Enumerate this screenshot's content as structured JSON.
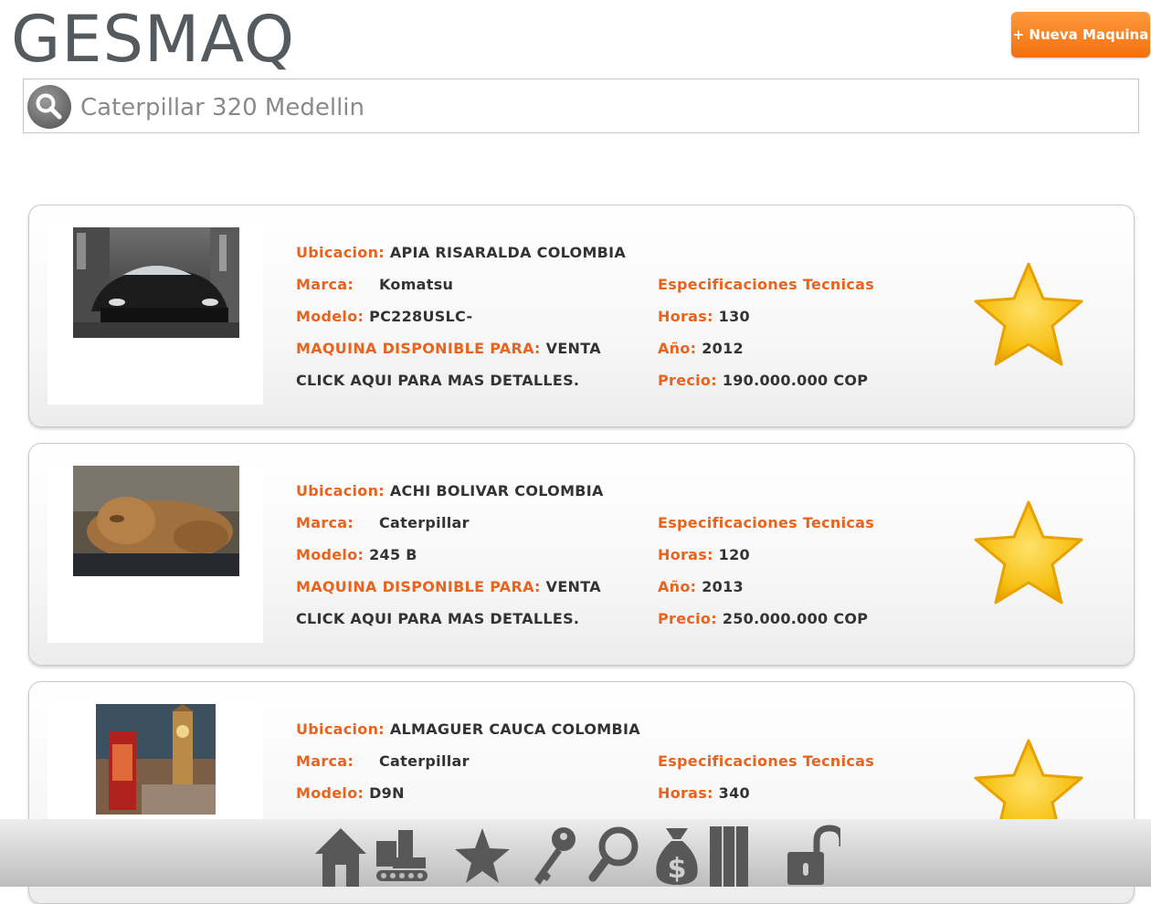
{
  "app": {
    "title": "GESMAQ",
    "new_button": "+ Nueva Maquina"
  },
  "search": {
    "value": "",
    "placeholder": "Caterpillar 320 Medellin"
  },
  "labels": {
    "ubicacion": "Ubicacion:",
    "marca": "Marca:",
    "modelo": "Modelo:",
    "disponible": "MAQUINA DISPONIBLE PARA:",
    "especificaciones": "Especificaciones Tecnicas",
    "horas": "Horas:",
    "anio": "Año:",
    "precio": "Precio:",
    "detalles": "CLICK AQUI PARA MAS DETALLES."
  },
  "listings": [
    {
      "ubicacion": "APIA RISARALDA COLOMBIA",
      "marca": "Komatsu",
      "modelo": "PC228USLC-",
      "disponible": "VENTA",
      "horas": "130",
      "anio": "2012",
      "precio": "190.000.000 COP",
      "image": "sports-car-photo"
    },
    {
      "ubicacion": "ACHI BOLIVAR COLOMBIA",
      "marca": "Caterpillar",
      "modelo": "245 B",
      "disponible": "VENTA",
      "horas": "120",
      "anio": "2013",
      "precio": "250.000.000 COP",
      "image": "lion-cub-photo"
    },
    {
      "ubicacion": "ALMAGUER CAUCA COLOMBIA",
      "marca": "Caterpillar",
      "modelo": "D9N",
      "disponible": "",
      "horas": "340",
      "anio": "",
      "precio": "",
      "image": "london-big-ben-photo"
    }
  ],
  "nav": [
    "home-icon",
    "machinery-icon",
    "star-icon",
    "key-icon",
    "search-icon",
    "money-bag-icon",
    "columns-icon",
    "unlock-icon"
  ],
  "colors": {
    "accent": "#e8641e",
    "button": "#f57a1c",
    "logo": "#555a5e"
  }
}
